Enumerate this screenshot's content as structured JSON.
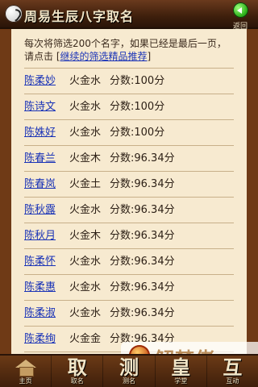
{
  "header": {
    "title": "周易生辰八字取名",
    "back_label": "返回"
  },
  "intro": {
    "text": "每次将筛选200个名字，如果已经是最后一页，请点击 [",
    "link": "继续的筛选精品推荐",
    "suffix": "]"
  },
  "names": [
    {
      "name": "陈柔妙",
      "elements": "火金水",
      "score": "分数:100分"
    },
    {
      "name": "陈诗文",
      "elements": "火金水",
      "score": "分数:100分"
    },
    {
      "name": "陈姝好",
      "elements": "火金水",
      "score": "分数:100分"
    },
    {
      "name": "陈春兰",
      "elements": "火金木",
      "score": "分数:96.34分"
    },
    {
      "name": "陈春岚",
      "elements": "火金土",
      "score": "分数:96.34分"
    },
    {
      "name": "陈秋露",
      "elements": "火金水",
      "score": "分数:96.34分"
    },
    {
      "name": "陈秋月",
      "elements": "火金木",
      "score": "分数:96.34分"
    },
    {
      "name": "陈柔怀",
      "elements": "火金水",
      "score": "分数:96.34分"
    },
    {
      "name": "陈柔惠",
      "elements": "火金水",
      "score": "分数:96.34分"
    },
    {
      "name": "陈柔淑",
      "elements": "火金水",
      "score": "分数:96.34分"
    },
    {
      "name": "陈柔绚",
      "elements": "火金金",
      "score": "分数:96.34分"
    }
  ],
  "bottom_nav": [
    {
      "glyph": "",
      "label": "主页",
      "icon": "house-icon"
    },
    {
      "glyph": "取",
      "label": "取名"
    },
    {
      "glyph": "测",
      "label": "测名"
    },
    {
      "glyph": "皇",
      "label": "学堂"
    },
    {
      "glyph": "互",
      "label": "互动"
    }
  ],
  "watermark": {
    "text": "解梦佬"
  }
}
